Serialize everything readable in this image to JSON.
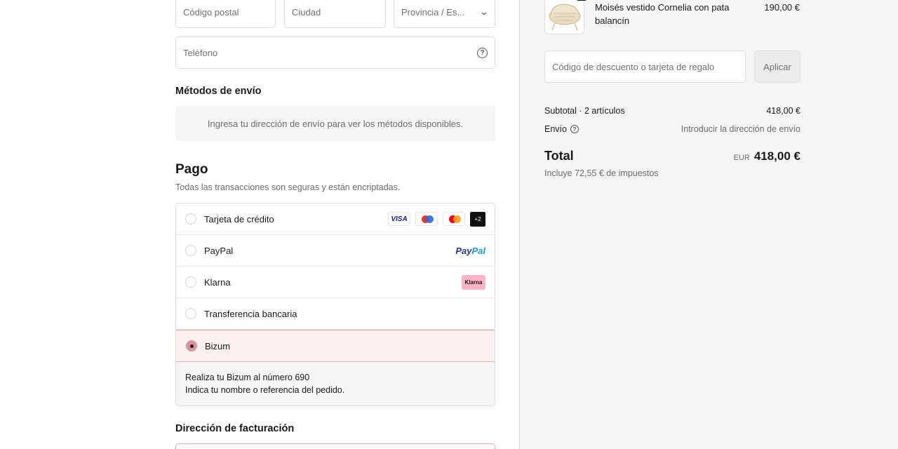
{
  "form": {
    "postal_placeholder": "Código postal",
    "city_placeholder": "Ciudad",
    "province_value": "Provincia / Es...",
    "phone_placeholder": "Teléfono"
  },
  "shipping": {
    "heading": "Métodos de envío",
    "info": "Ingresa tu dirección de envío para ver los métodos disponibles."
  },
  "payment": {
    "heading": "Pago",
    "subtitle": "Todas las transacciones son seguras y están encriptadas.",
    "methods": [
      {
        "label": "Tarjeta de crédito",
        "selected": false
      },
      {
        "label": "PayPal",
        "selected": false
      },
      {
        "label": "Klarna",
        "selected": false
      },
      {
        "label": "Transferencia bancaria",
        "selected": false
      },
      {
        "label": "Bizum",
        "selected": true
      }
    ],
    "card_logos": {
      "visa": "VISA",
      "more": "+2"
    },
    "paypal_logo": {
      "a": "Pay",
      "b": "Pal"
    },
    "klarna_logo": "Klarna",
    "bizum_info_line1": "Realiza tu Bizum al número 690",
    "bizum_info_line2": "Indica tu nombre o referencia del pedido."
  },
  "billing": {
    "heading": "Dirección de facturación"
  },
  "summary": {
    "item_name": "Moisés vestido Cornelia con pata balancín",
    "item_price": "190,00 €",
    "discount_placeholder": "Código de descuento o tarjeta de regalo",
    "apply_label": "Aplicar",
    "subtotal_label": "Subtotal · 2 artículos",
    "subtotal_value": "418,00 €",
    "shipping_label": "Envío",
    "shipping_value": "Introducir la dirección de envío",
    "total_label": "Total",
    "total_currency": "EUR",
    "total_value": "418,00 €",
    "tax_note": "Incluye 72,55 € de impuestos"
  },
  "colors": {
    "selected_bg": "#fdf0f1",
    "selected_border": "#e7a5ae",
    "radio_selected": "#d8939c",
    "sidebar_bg": "#f5f5f5"
  }
}
